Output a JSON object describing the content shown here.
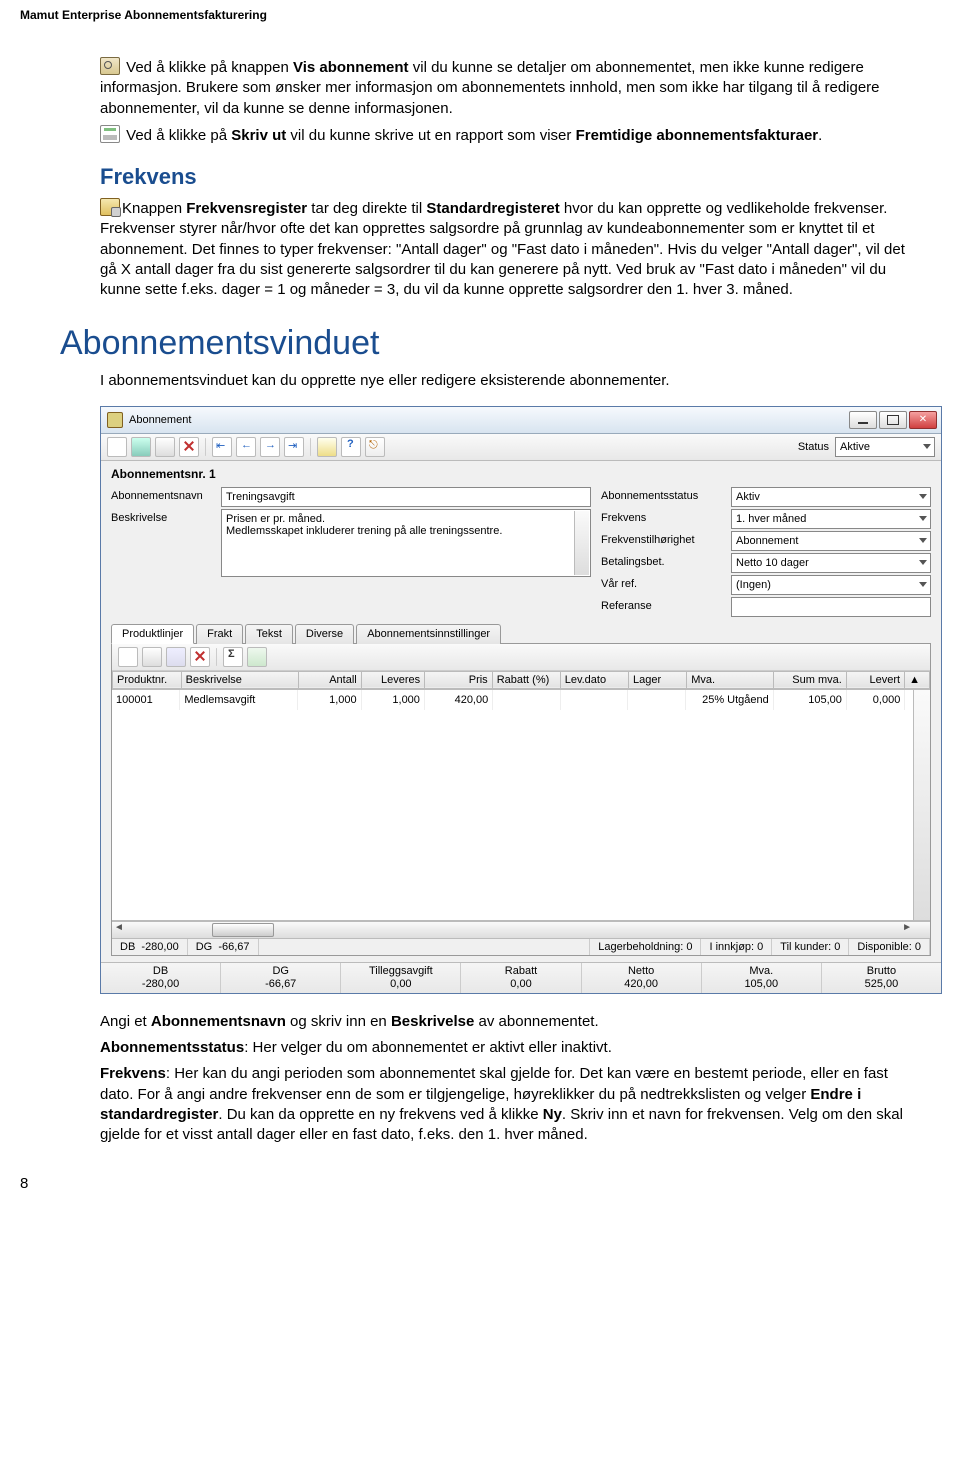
{
  "doc": {
    "header": "Mamut Enterprise Abonnementsfakturering",
    "page_number": "8"
  },
  "text": {
    "p1_a": " Ved å klikke på knappen ",
    "p1_b": "Vis abonnement",
    "p1_c": " vil du kunne se detaljer om abonnementet, men ikke kunne redigere informasjon. Brukere som ønsker mer informasjon om abonnementets innhold, men som ikke har tilgang til å redigere abonnementer, vil da kunne se denne informasjonen.",
    "p2_a": " Ved å klikke på ",
    "p2_b": "Skriv ut",
    "p2_c": " vil du kunne skrive ut en rapport som viser ",
    "p2_d": "Fremtidige abonnementsfakturaer",
    "p2_e": ".",
    "h_frekvens": "Frekvens",
    "p3_a": "Knappen ",
    "p3_b": "Frekvensregister",
    "p3_c": " tar deg direkte til ",
    "p3_d": "Standardregisteret",
    "p3_e": " hvor du kan opprette og vedlikeholde frekvenser. Frekvenser styrer når/hvor ofte det kan opprettes salgsordre på grunnlag av kundeabonnementer som er knyttet til et abonnement. Det finnes to typer frekvenser: \"Antall dager\" og \"Fast dato i måneden\". Hvis du velger \"Antall dager\", vil det gå X antall dager fra du sist genererte salgsordrer til du kan generere på nytt. Ved bruk av \"Fast dato i måneden\" vil du kunne sette f.eks. dager = 1 og måneder = 3, du vil da kunne opprette salgsordrer den 1. hver 3. måned.",
    "h_vindu": "Abonnementsvinduet",
    "p4": "I abonnementsvinduet kan du opprette nye eller redigere eksisterende abonnementer.",
    "p5_a": "Angi et ",
    "p5_b": "Abonnementsnavn",
    "p5_c": " og skriv inn en ",
    "p5_d": "Beskrivelse",
    "p5_e": " av abonnementet.",
    "p6_a": "Abonnementsstatus",
    "p6_b": ": Her velger du om abonnementet er aktivt eller inaktivt.",
    "p7_a": "Frekvens",
    "p7_b": ": Her kan du angi perioden som abonnementet skal gjelde for. Det kan være en bestemt periode, eller en fast dato. For å angi andre frekvenser enn de som er tilgjengelige, høyreklikker du på nedtrekkslisten og velger ",
    "p7_c": "Endre i standardregister",
    "p7_d": ". Du kan da opprette en ny frekvens ved å klikke ",
    "p7_e": "Ny",
    "p7_f": ". Skriv inn et navn for frekvensen. Velg om den skal gjelde for et visst antall dager eller en fast dato, f.eks. den 1. hver måned."
  },
  "win": {
    "title": "Abonnement",
    "status_label": "Status",
    "status_value": "Aktive",
    "header_id": "Abonnementsnr. 1",
    "labels": {
      "navn": "Abonnementsnavn",
      "beskrivelse": "Beskrivelse",
      "abostatus": "Abonnementsstatus",
      "frekvens": "Frekvens",
      "frekvenstil": "Frekvenstilhørighet",
      "betaling": "Betalingsbet.",
      "varref": "Vår ref.",
      "referanse": "Referanse"
    },
    "values": {
      "navn": "Treningsavgift",
      "beskrivelse": "Prisen er pr. måned.\nMedlemsskapet inkluderer trening på alle treningssentre.",
      "abostatus": "Aktiv",
      "frekvens": "1. hver måned",
      "frekvenstil": "Abonnement",
      "betaling": "Netto 10 dager",
      "varref": "(Ingen)",
      "referanse": ""
    },
    "tabs": [
      "Produktlinjer",
      "Frakt",
      "Tekst",
      "Diverse",
      "Abonnementsinnstillinger"
    ],
    "grid_headers": [
      "Produktnr.",
      "Beskrivelse",
      "Antall",
      "Leveres",
      "Pris",
      "Rabatt (%)",
      "Lev.dato",
      "Lager",
      "Mva.",
      "Sum mva.",
      "Levert"
    ],
    "grid_row": {
      "nr": "100001",
      "besk": "Medlemsavgift",
      "antall": "1,000",
      "leveres": "1,000",
      "pris": "420,00",
      "rabatt": "",
      "levdato": "",
      "lager": "",
      "mva": "25% Utgåend",
      "summva": "105,00",
      "levert": "0,000"
    },
    "statusline": {
      "db_label": "DB",
      "db_val": "-280,00",
      "dg_label": "DG",
      "dg_val": "-66,67",
      "lager": "Lagerbeholdning: 0",
      "innkjop": "I innkjøp: 0",
      "tilkunder": "Til kunder: 0",
      "disp": "Disponible: 0"
    },
    "totals": [
      {
        "label": "DB",
        "value": "-280,00"
      },
      {
        "label": "DG",
        "value": "-66,67"
      },
      {
        "label": "Tilleggsavgift",
        "value": "0,00"
      },
      {
        "label": "Rabatt",
        "value": "0,00"
      },
      {
        "label": "Netto",
        "value": "420,00"
      },
      {
        "label": "Mva.",
        "value": "105,00"
      },
      {
        "label": "Brutto",
        "value": "525,00"
      }
    ]
  }
}
